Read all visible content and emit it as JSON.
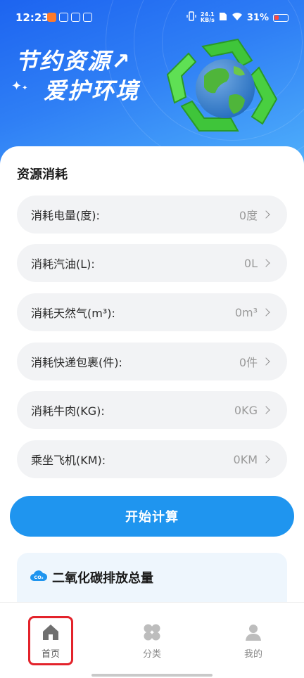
{
  "status_bar": {
    "time": "12:23",
    "speed_value": "24.1",
    "speed_unit": "KB/s",
    "battery": "31%"
  },
  "banner": {
    "line1": "节约资源↗",
    "line2": "爱护环境"
  },
  "section": {
    "title": "资源消耗"
  },
  "items": [
    {
      "label": "消耗电量(度):",
      "value": "0度"
    },
    {
      "label": "消耗汽油(L):",
      "value": "0L"
    },
    {
      "label": "消耗天然气(m³):",
      "value": "0m³"
    },
    {
      "label": "消耗快递包裹(件):",
      "value": "0件"
    },
    {
      "label": "消耗牛肉(KG):",
      "value": "0KG"
    },
    {
      "label": "乘坐飞机(KM):",
      "value": "0KM"
    }
  ],
  "calc_button": "开始计算",
  "co2": {
    "icon_text": "CO₂",
    "title": "二氧化碳排放总量"
  },
  "nav": {
    "home": "首页",
    "category": "分类",
    "me": "我的"
  },
  "colors": {
    "primary": "#1f95ef",
    "highlight": "#e3232b"
  }
}
